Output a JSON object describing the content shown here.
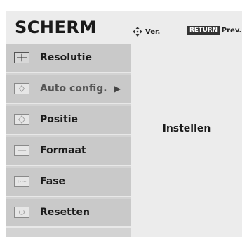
{
  "header": {
    "title": "SCHERM",
    "move_hint": "Ver.",
    "return_key": "RETURN",
    "return_hint": "Prev."
  },
  "menu": {
    "items": [
      {
        "label": "Resolutie",
        "icon": "resolution-icon",
        "state": "selected"
      },
      {
        "label": "Auto config.",
        "icon": "auto-config-icon",
        "state": "dim",
        "arrow": "▶"
      },
      {
        "label": "Positie",
        "icon": "position-icon",
        "state": "normal"
      },
      {
        "label": "Formaat",
        "icon": "size-icon",
        "state": "normal"
      },
      {
        "label": "Fase",
        "icon": "phase-icon",
        "state": "normal"
      },
      {
        "label": "Resetten",
        "icon": "reset-icon",
        "state": "normal"
      }
    ]
  },
  "panel": {
    "text": "Instellen"
  },
  "colors": {
    "menu_background": "#c9c9c9",
    "panel_background": "#ececec",
    "text": "#1a1a1a",
    "return_key_background": "#333333"
  }
}
